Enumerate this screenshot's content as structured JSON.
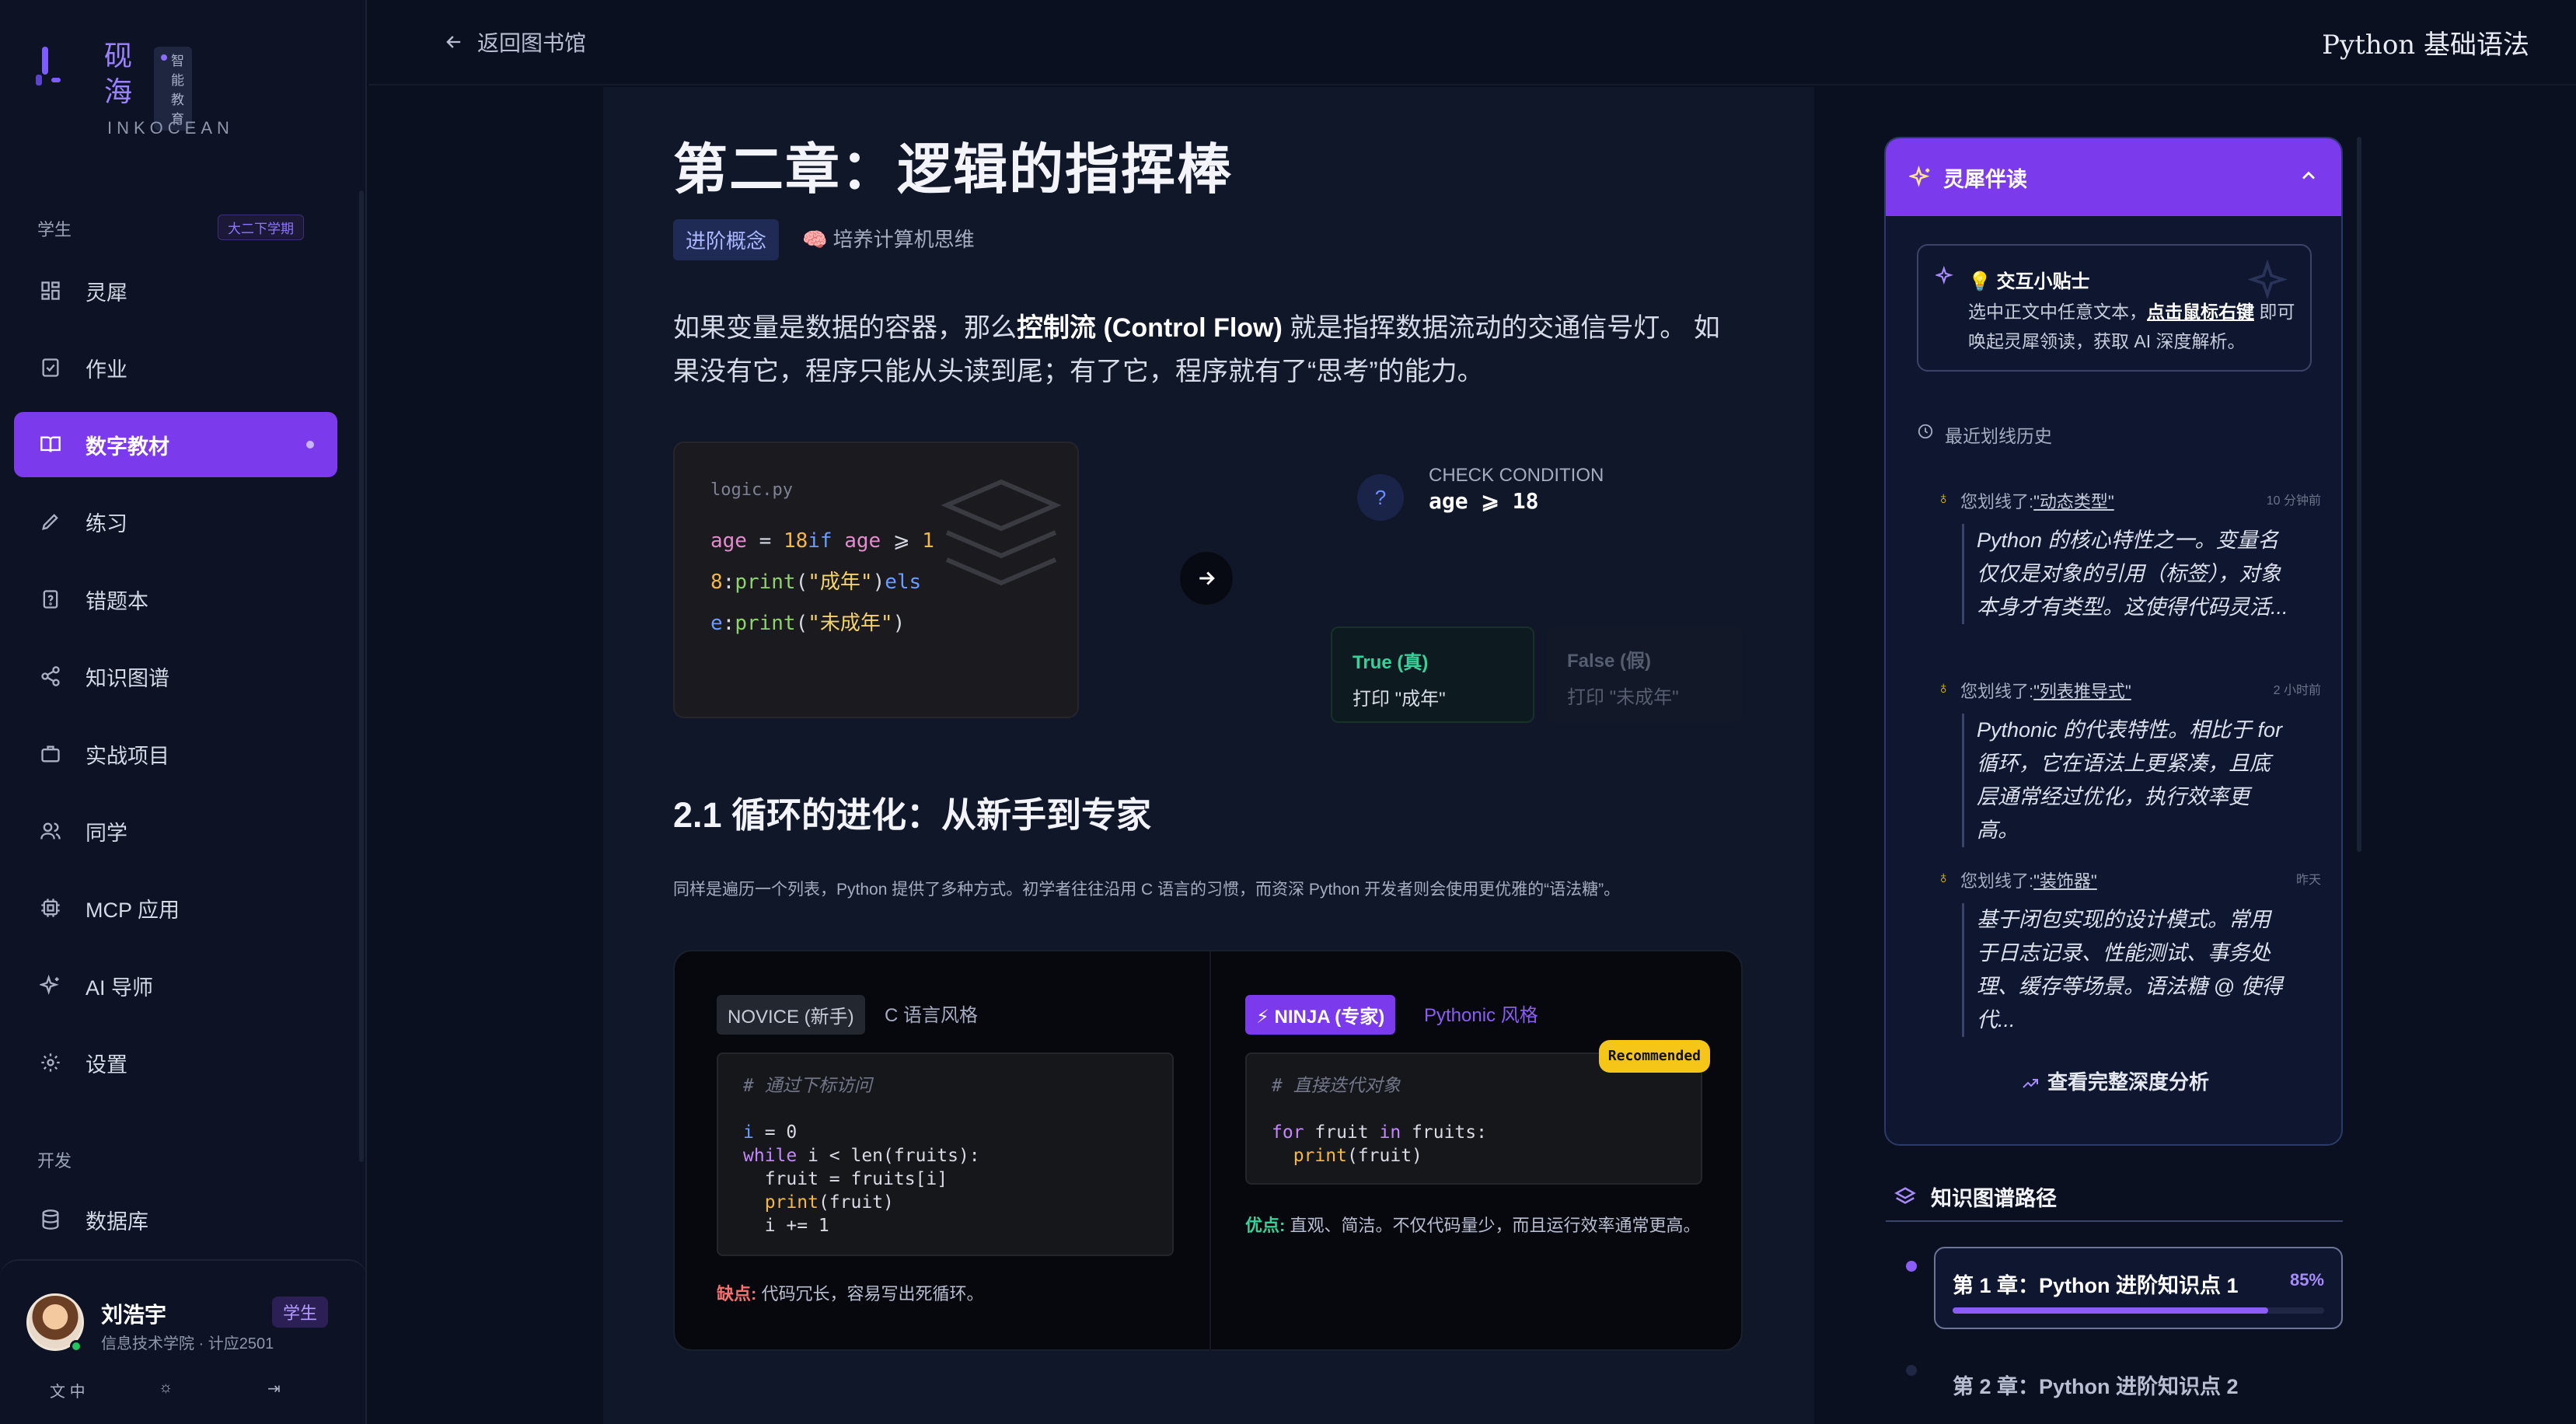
{
  "colors": {
    "accent": "#7c3aed",
    "background": "#0b1020",
    "success": "#34d399",
    "danger": "#f87171"
  },
  "brand": {
    "name_cn": "砚海",
    "badge": "智能教育",
    "name_en": "INKOCEAN"
  },
  "sidebar": {
    "section_student": "学生",
    "term": "大二下学期",
    "items": [
      {
        "label": "灵犀",
        "icon": "grid-icon"
      },
      {
        "label": "作业",
        "icon": "clipboard-check-icon"
      },
      {
        "label": "数字教材",
        "icon": "book-open-icon",
        "active": true
      },
      {
        "label": "练习",
        "icon": "pencil-icon"
      },
      {
        "label": "错题本",
        "icon": "file-question-icon"
      },
      {
        "label": "知识图谱",
        "icon": "share-icon"
      },
      {
        "label": "实战项目",
        "icon": "briefcase-icon"
      },
      {
        "label": "同学",
        "icon": "users-icon"
      },
      {
        "label": "MCP 应用",
        "icon": "cpu-icon"
      },
      {
        "label": "AI 导师",
        "icon": "sparkles-icon"
      },
      {
        "label": "设置",
        "icon": "gear-icon"
      }
    ],
    "section_dev": "开发",
    "dev_items": [
      {
        "label": "数据库",
        "icon": "database-icon"
      }
    ]
  },
  "user": {
    "name": "刘浩宇",
    "role": "学生",
    "org": "信息技术学院 · 计应2501",
    "lang": "中"
  },
  "topbar": {
    "back": "返回图书馆",
    "title": "Python 基础语法"
  },
  "article": {
    "chapter_title": "第二章：逻辑的指挥棒",
    "tag_level": "进阶概念",
    "tag_goal": "🧠 培养计算机思维",
    "intro_pre": "如果变量是数据的容器，那么",
    "intro_bold": "控制流 (Control Flow)",
    "intro_post": " 就是指挥数据流动的交通信号灯。 如果没有它，程序只能从头读到尾；有了它，程序就有了“思考”的能力。",
    "code_file": "logic.py",
    "check_label": "CHECK CONDITION",
    "check_expr": "age ⩾ 18",
    "true_label": "True (真)",
    "true_action": "打印 \"成年\"",
    "false_label": "False (假)",
    "false_action": "打印 \"未成年\"",
    "section_title": "2.1 循环的进化：从新手到专家",
    "section_desc": "同样是遍历一个列表，Python 提供了多种方式。初学者往往沿用 C 语言的习惯，而资深 Python 开发者则会使用更优雅的“语法糖”。",
    "novice_badge": "NOVICE (新手)",
    "novice_style": "C 语言风格",
    "novice_comment": "# 通过下标访问",
    "novice_note_label": "缺点:",
    "novice_note": " 代码冗长，容易写出死循环。",
    "ninja_badge": "⚡ NINJA (专家)",
    "ninja_style": "Pythonic 风格",
    "ninja_recommended": "Recommended",
    "ninja_comment": "# 直接迭代对象",
    "ninja_note_label": "优点:",
    "ninja_note": " 直观、简洁。不仅代码量少，而且运行效率通常更高。"
  },
  "panel": {
    "title": "灵犀伴读",
    "tip_title": "💡 交互小贴士",
    "tip_pre": "选中正文中任意文本，",
    "tip_link": "点击鼠标右键",
    "tip_post": " 即可唤起灵犀领读，获取 AI 深度解析。",
    "history_label": "最近划线历史",
    "history": [
      {
        "prefix": "您划线了:",
        "term": "\"动态类型\"",
        "time": "10 分钟前",
        "text": "Python 的核心特性之一。变量名仅仅是对象的引用（标签），对象本身才有类型。这使得代码灵活..."
      },
      {
        "prefix": "您划线了:",
        "term": "\"列表推导式\"",
        "time": "2 小时前",
        "text": "Pythonic 的代表特性。相比于 for 循环，它在语法上更紧凑，且底层通常经过优化，执行效率更高。"
      },
      {
        "prefix": "您划线了:",
        "term": "\"装饰器\"",
        "time": "昨天",
        "text": "基于闭包实现的设计模式。常用于日志记录、性能测试、事务处理、缓存等场景。语法糖 @ 使得代..."
      }
    ],
    "more": "查看完整深度分析"
  },
  "knowledge": {
    "title": "知识图谱路径",
    "items": [
      {
        "name": "第 1 章：Python 进阶知识点 1",
        "progress_label": "85%",
        "progress": 0.85
      },
      {
        "name": "第 2 章：Python 进阶知识点 2"
      }
    ]
  }
}
